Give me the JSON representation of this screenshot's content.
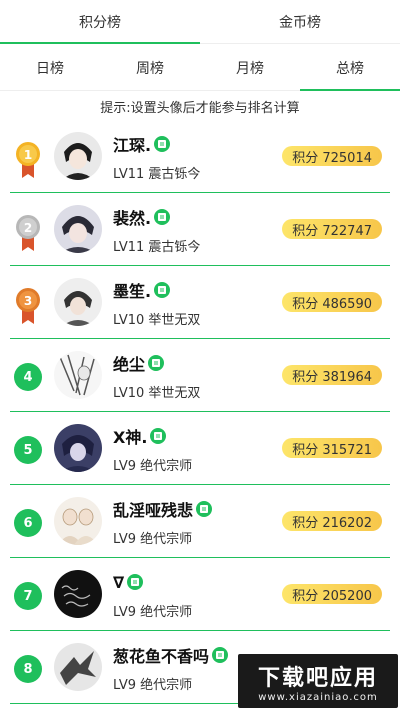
{
  "top_tabs": [
    {
      "label": "积分榜",
      "active": true
    },
    {
      "label": "金币榜",
      "active": false
    }
  ],
  "sub_tabs": [
    {
      "label": "日榜",
      "active": false
    },
    {
      "label": "周榜",
      "active": false
    },
    {
      "label": "月榜",
      "active": false
    },
    {
      "label": "总榜",
      "active": true
    }
  ],
  "hint": "提示:设置头像后才能参与排名计算",
  "entries": [
    {
      "rank": "1",
      "medal": "gold",
      "name": "江琛.",
      "level": "LV11 震古铄今",
      "score": "积分 725014",
      "avatar": "avatar-1"
    },
    {
      "rank": "2",
      "medal": "silver",
      "name": "裴然.",
      "level": "LV11 震古铄今",
      "score": "积分 722747",
      "avatar": "avatar-2"
    },
    {
      "rank": "3",
      "medal": "bronze",
      "name": "墨笙.",
      "level": "LV10 举世无双",
      "score": "积分 486590",
      "avatar": "avatar-3"
    },
    {
      "rank": "4",
      "medal": "none",
      "name": "绝尘",
      "level": "LV10 举世无双",
      "score": "积分 381964",
      "avatar": "avatar-4"
    },
    {
      "rank": "5",
      "medal": "none",
      "name": "X神.",
      "level": "LV9 绝代宗师",
      "score": "积分 315721",
      "avatar": "avatar-5"
    },
    {
      "rank": "6",
      "medal": "none",
      "name": "乱淫哑残悲",
      "level": "LV9 绝代宗师",
      "score": "积分 216202",
      "avatar": "avatar-6"
    },
    {
      "rank": "7",
      "medal": "none",
      "name": "∇",
      "level": "LV9 绝代宗师",
      "score": "积分 205200",
      "avatar": "avatar-7"
    },
    {
      "rank": "8",
      "medal": "none",
      "name": "葱花鱼不香吗",
      "level": "LV9 绝代宗师",
      "score": "",
      "avatar": "avatar-8"
    }
  ],
  "colors": {
    "accent": "#1fbf5c",
    "gold": "#f4b324",
    "silver": "#b7b7b7",
    "bronze": "#e07b2a",
    "score_bg": "#fbd75a"
  },
  "watermark": {
    "title": "下载吧应用",
    "url": "www.xiazainiao.com"
  }
}
